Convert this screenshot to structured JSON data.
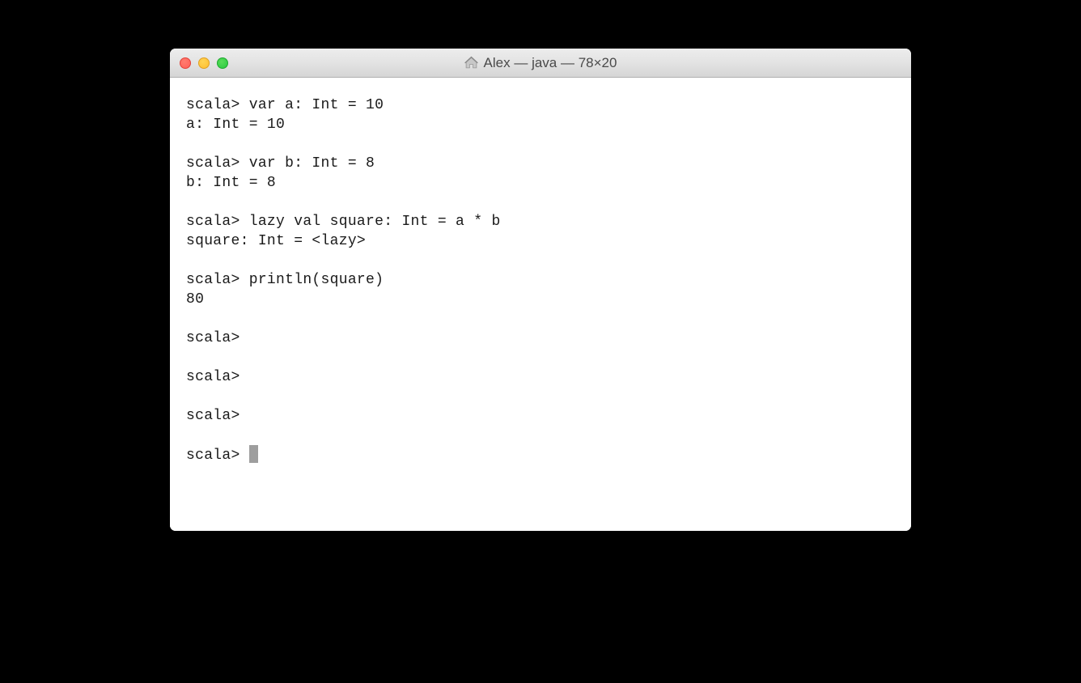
{
  "window": {
    "title": "Alex — java — 78×20"
  },
  "terminal": {
    "lines": [
      "scala> var a: Int = 10",
      "a: Int = 10",
      "",
      "scala> var b: Int = 8",
      "b: Int = 8",
      "",
      "scala> lazy val square: Int = a * b",
      "square: Int = <lazy>",
      "",
      "scala> println(square)",
      "80",
      "",
      "scala>",
      "",
      "scala>",
      "",
      "scala>",
      "",
      "scala> "
    ],
    "cursor_line_index": 18
  }
}
